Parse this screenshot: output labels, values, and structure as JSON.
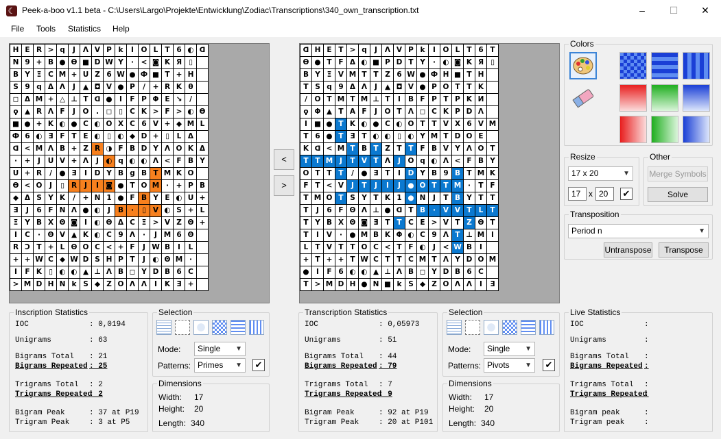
{
  "window": {
    "title": "Peek-a-boo v1.1 beta - C:\\Users\\Largo\\Projekte\\Entwicklung\\Zodiac\\Transcriptions\\340_own_transcription.txt",
    "minimize_glyph": "–",
    "maximize_glyph": "☐",
    "close_glyph": "✕",
    "app_icon_glyph": "☾"
  },
  "menu": [
    "File",
    "Tools",
    "Statistics",
    "Help"
  ],
  "nav": {
    "prev": "<",
    "next": ">"
  },
  "left_grid": {
    "rows": [
      "HER>qJΛVPkIOLT6◐ᗡ",
      "N9+B●Ө■DWY·<◙KЯ▯",
      "BYΞCM+UZ6W●Ф■T+H",
      "Ѕ9qΔΛJ▲◘V●P/+RKθ",
      "◻ΔM+△⊥Tᗡ●IFPΦE↘/",
      "ϙ▲RΛFJO.◻▯CK>F>◐Ө",
      "■●+K◐●C◐OXC6V+◆ML",
      "Ф6◐ƎFTE◐▯◐◆D+▯LΔ",
      "ᗡ<MΛB+ZR◑FBDYΛOKΔ",
      "·+JUV+ΛJ◐q◐◐Λ<FBY",
      "U+R/●ƎIDYBgBTMKO",
      "Ө<OJ▯RJI◙●TOM·+PBF",
      "◆ΔSYK/+N1●FBYE◐U+",
      "ƎJ6FNΛ●◐JB·▯V◐Ѕ+L",
      "ΞYBXΘ◙I◐ΘΔCΞ>VZΘ+",
      "IC·ΘV▲K◐C9Λ·JM6Θ",
      "RƆT+LΘOC<+FJWBIL",
      "++WC◆WDSHPTJ◐ΘM·",
      "IFK▯◐◐▲⊥ΛB◻YDB6C",
      ">MDHNkS◆ZOΛΛIKƎ+"
    ]
  },
  "right_grid": {
    "rows": [
      "ᗡHET>qJΛVPkIOLT6T",
      "Ө●TFΔ◐■PDTY·◐◙KЯ▯",
      "BYΞVMTTZ6W●ФH■TH",
      "TSq9ΔΛJ▲◘V●POTTK",
      "/OTMTM⊥TIBFPTPKИ",
      "ϙΦ▲TAFJOTΛ◻CKPDΛ",
      "I■●TK◐●C◐OTTVX6VM",
      "T6●TƎT◐◐▯◐YMTDOE",
      "Kᗡ<MTBTZTTFBVYΛOT",
      "TTMJTVTΛJOq◐Λ<FBY",
      "OTTT/●ƎTIDYB9BTMK",
      "FT<VJTJIJ●OTTM·TF",
      "TMOTSYTK1●NJTBYTT",
      "TJ6FΘΛ⊥●ᗡTB·VVTLT",
      "TYBXΘ◙ƎTTCE>VTZΘT",
      "TIV·●MBKΦ◐C9ΛT⊥MI",
      "LTVTTOC<TF◐J<WBI",
      "+T++TWCTTCMTΛYDOM",
      "●IF6◐◐▲⊥ΛB◻YDB6C",
      "T>MDH●N■kS◆ZOΛΛIƎ"
    ]
  },
  "colors": {
    "title": "Colors",
    "orange": "#f7801e",
    "blue": "#0b79d0",
    "panel_bg": "#a9a9a9"
  },
  "resize": {
    "title": "Resize",
    "dims_option": "17 x 20",
    "cols": "17",
    "rows": "20",
    "x_label": "x"
  },
  "other": {
    "title": "Other",
    "merge_label": "Merge Symbols",
    "solve_label": "Solve"
  },
  "transposition": {
    "title": "Transposition",
    "mode": "Period n",
    "untranspose_label": "Untranspose",
    "transpose_label": "Transpose"
  },
  "left_stats": {
    "title": "Inscription Statistics",
    "lines": [
      {
        "label": "IOC",
        "value": ": 0,0194",
        "bold": false
      },
      {
        "label": "Unigrams",
        "value": ": 63",
        "bold": false
      },
      {
        "label": "Bigrams Total",
        "value": ": 21",
        "bold": false
      },
      {
        "label": "Bigrams Repeated",
        "value": ": 25",
        "bold": true
      },
      {
        "label": "Trigrams Total",
        "value": ": 2",
        "bold": false
      },
      {
        "label": "Trigrams Repeated",
        "value": ": 2",
        "bold": true
      },
      {
        "label": "Bigram Peak",
        "value": ": 37 at P19",
        "bold": false
      },
      {
        "label": "Trigram Peak",
        "value": ": 3 at P5",
        "bold": false
      }
    ]
  },
  "mid_stats": {
    "title": "Transcription Statistics",
    "lines": [
      {
        "label": "IOC",
        "value": ": 0,05973",
        "bold": false
      },
      {
        "label": "Unigrams",
        "value": ": 51",
        "bold": false
      },
      {
        "label": "Bigrams Total",
        "value": ": 44",
        "bold": false
      },
      {
        "label": "Bigrams Repeated",
        "value": ": 79",
        "bold": true
      },
      {
        "label": "Trigrams Total",
        "value": ": 7",
        "bold": false
      },
      {
        "label": "Trigrams Repeated",
        "value": ": 9",
        "bold": true
      },
      {
        "label": "Bigram Peak",
        "value": ": 92 at P19",
        "bold": false
      },
      {
        "label": "Trigram Peak",
        "value": ": 20 at P101",
        "bold": false
      }
    ]
  },
  "live_stats": {
    "title": "Live Statistics",
    "lines": [
      {
        "label": "IOC",
        "value": ":",
        "bold": false
      },
      {
        "label": "Unigrams",
        "value": ":",
        "bold": false
      },
      {
        "label": "Bigrams Total",
        "value": ":",
        "bold": false
      },
      {
        "label": "Bigrams Repeated",
        "value": ":",
        "bold": true
      },
      {
        "label": "Trigrams Total",
        "value": ":",
        "bold": false
      },
      {
        "label": "Trigrams Repeated",
        "value": ":",
        "bold": true
      },
      {
        "label": "Bigram peak",
        "value": ":",
        "bold": false
      },
      {
        "label": "Trigram peak",
        "value": ":",
        "bold": false
      }
    ]
  },
  "selection_left": {
    "title": "Selection",
    "mode_label": "Mode:",
    "mode": "Single",
    "patterns_label": "Patterns:",
    "pattern": "Primes",
    "checked": "✔"
  },
  "selection_mid": {
    "title": "Selection",
    "mode_label": "Mode:",
    "mode": "Single",
    "patterns_label": "Patterns:",
    "pattern": "Pivots",
    "checked": "✔"
  },
  "dims_left": {
    "title": "Dimensions",
    "width_label": "Width:",
    "width": "17",
    "height_label": "Height:",
    "height": "20",
    "length_label": "Length:",
    "length": "340"
  },
  "dims_mid": {
    "title": "Dimensions",
    "width_label": "Width:",
    "width": "17",
    "height_label": "Height:",
    "height": "20",
    "length_label": "Length:",
    "length": "340"
  }
}
